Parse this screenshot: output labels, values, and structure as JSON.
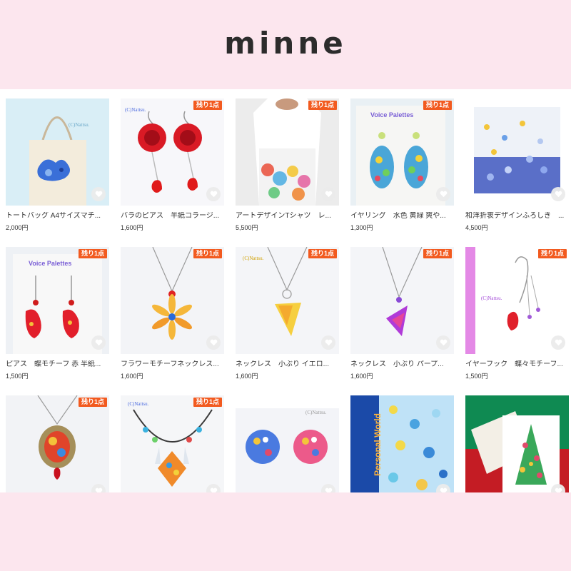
{
  "header": {
    "logo": "minne"
  },
  "colors": {
    "background": "#fce6ee",
    "badge": "#f25a1f",
    "fav_bg": "#ebebeb",
    "fav_heart": "#ffffff"
  },
  "icons": {
    "favorite": "heart-icon"
  },
  "products": [
    {
      "title": "トートバッグ A4サイズマチ...",
      "price": "2,000円",
      "badge": "",
      "thumb_text": "(C)Nattsu."
    },
    {
      "title": "バラのピアス　半紙コラージ...",
      "price": "1,600円",
      "badge": "残り1点",
      "thumb_text": "(C)Nattsu."
    },
    {
      "title": "アートデザインTシャツ　レ...",
      "price": "5,500円",
      "badge": "残り1点",
      "thumb_text": ""
    },
    {
      "title": "イヤリング　水色 黄緑 爽や...",
      "price": "1,300円",
      "badge": "残り1点",
      "thumb_text": "Voice Palettes"
    },
    {
      "title": "和洋折衷デザインふろしき　...",
      "price": "4,500円",
      "badge": "",
      "thumb_text": ""
    },
    {
      "title": "ピアス　蝶モチーフ 赤 半紙...",
      "price": "1,500円",
      "badge": "残り1点",
      "thumb_text": "Voice Palettes"
    },
    {
      "title": "フラワーモチーフネックレス...",
      "price": "1,600円",
      "badge": "残り1点",
      "thumb_text": ""
    },
    {
      "title": "ネックレス　小ぶり イエロ...",
      "price": "1,600円",
      "badge": "残り1点",
      "thumb_text": "(C)Nattsu."
    },
    {
      "title": "ネックレス　小ぶり パープ...",
      "price": "1,600円",
      "badge": "残り1点",
      "thumb_text": ""
    },
    {
      "title": "イヤーフック　蝶々モチーフ...",
      "price": "1,500円",
      "badge": "残り1点",
      "thumb_text": "(C)Nattsu."
    },
    {
      "title": "",
      "price": "",
      "badge": "残り1点",
      "thumb_text": ""
    },
    {
      "title": "",
      "price": "",
      "badge": "残り1点",
      "thumb_text": "(C)Nattsu."
    },
    {
      "title": "",
      "price": "",
      "badge": "",
      "thumb_text": "(C)Nattsu."
    },
    {
      "title": "",
      "price": "",
      "badge": "",
      "thumb_text": "Personal World"
    },
    {
      "title": "",
      "price": "",
      "badge": "",
      "thumb_text": ""
    }
  ]
}
